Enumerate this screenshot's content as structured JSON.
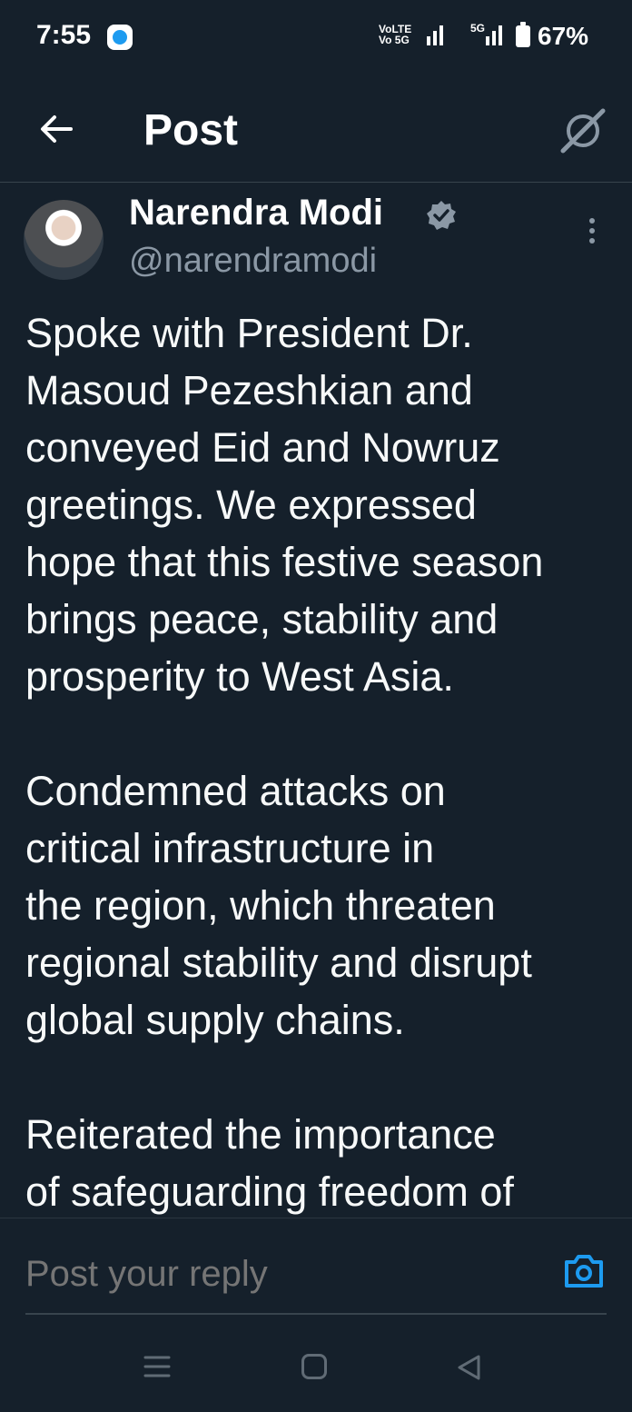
{
  "status_bar": {
    "time": "7:55",
    "volte_line1": "VoLTE",
    "volte_line2": "Vo 5G",
    "network": "5G",
    "battery": "67%"
  },
  "header": {
    "title": "Post",
    "back_icon": "arrow-left-icon",
    "grok_icon": "grok-icon"
  },
  "post": {
    "author_name": "Narendra Modi",
    "author_handle": "@narendramodi",
    "verified_icon": "verified-badge-icon",
    "lines": [
      "Spoke with President Dr.",
      "Masoud Pezeshkian and",
      "conveyed Eid and Nowruz",
      "greetings. We expressed",
      "hope that this festive season",
      "brings peace, stability and",
      "prosperity to West Asia.",
      "",
      "Condemned attacks on",
      "critical infrastructure in",
      "the region, which threaten",
      "regional stability and disrupt",
      "global supply chains.",
      "",
      "Reiterated the importance",
      "of safeguarding freedom of"
    ]
  },
  "reply": {
    "placeholder": "Post your reply",
    "camera_icon": "camera-icon"
  },
  "colors": {
    "background": "#15202b",
    "accent": "#1d9bf0",
    "secondary_text": "#8b98a5",
    "verified": "#8b98a5"
  }
}
